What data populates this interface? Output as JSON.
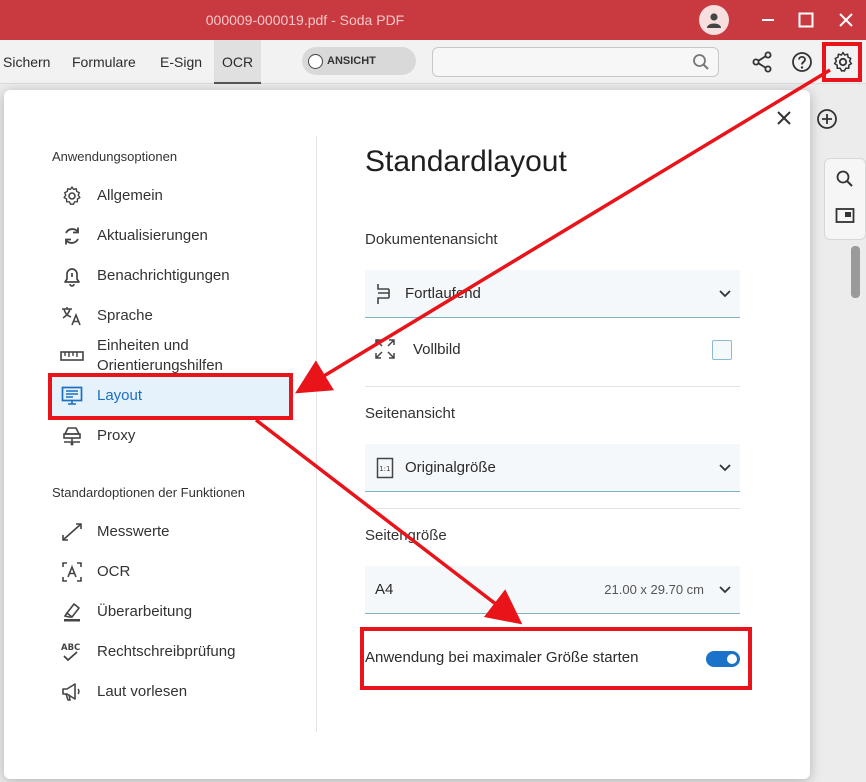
{
  "window": {
    "title": "000009-000019.pdf  -  Soda PDF"
  },
  "menu": {
    "items": [
      "Sichern",
      "Formulare",
      "E-Sign",
      "OCR"
    ],
    "view_toggle": "ANSICHT",
    "search_placeholder": ""
  },
  "dialog": {
    "section_app": "Anwendungsoptionen",
    "app_items": [
      {
        "label": "Allgemein",
        "icon": "gear-icon"
      },
      {
        "label": "Aktualisierungen",
        "icon": "sync-icon"
      },
      {
        "label": "Benachrichtigungen",
        "icon": "bell-icon"
      },
      {
        "label": "Sprache",
        "icon": "translate-icon"
      },
      {
        "label": "Einheiten und Orientierungshilfen",
        "icon": "ruler-icon"
      },
      {
        "label": "Layout",
        "icon": "layout-icon",
        "selected": true
      },
      {
        "label": "Proxy",
        "icon": "network-icon"
      }
    ],
    "section_features": "Standardoptionen der Funktionen",
    "feature_items": [
      {
        "label": "Messwerte",
        "icon": "measure-icon"
      },
      {
        "label": "OCR",
        "icon": "ocr-icon"
      },
      {
        "label": "Überarbeitung",
        "icon": "eraser-icon"
      },
      {
        "label": "Rechtschreibprüfung",
        "icon": "spellcheck-icon"
      },
      {
        "label": "Laut vorlesen",
        "icon": "megaphone-icon"
      }
    ],
    "content": {
      "title": "Standardlayout",
      "doc_view_label": "Dokumentenansicht",
      "doc_view_value": "Fortlaufend",
      "fullscreen_label": "Vollbild",
      "fullscreen_checked": false,
      "page_view_label": "Seitenansicht",
      "page_view_value": "Originalgröße",
      "page_size_label": "Seitengröße",
      "page_size_value": "A4",
      "page_size_dims": "21.00 x 29.70 cm",
      "start_max_label": "Anwendung bei maximaler Größe starten",
      "start_max_on": true
    }
  },
  "colors": {
    "titlebar": "#c93a40",
    "accent": "#1a72c9",
    "annotation": "#e8141a"
  }
}
